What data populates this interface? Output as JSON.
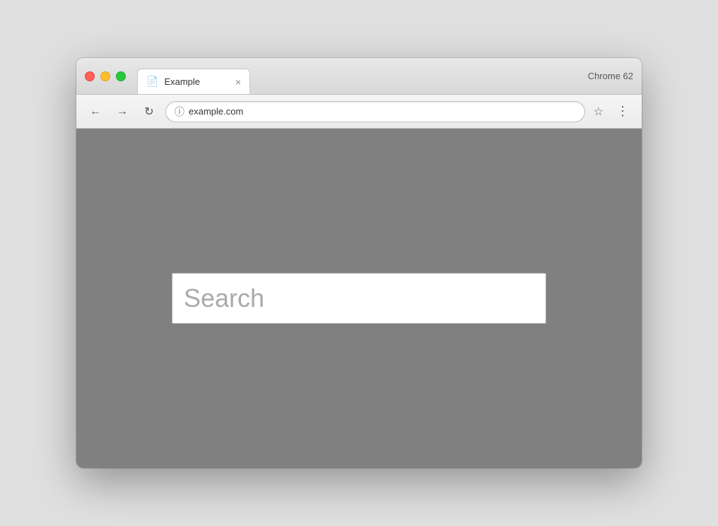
{
  "browser": {
    "chrome_label": "Chrome 62",
    "tab": {
      "title": "Example",
      "icon": "📄",
      "close": "×"
    },
    "toolbar": {
      "back_label": "←",
      "forward_label": "→",
      "reload_label": "↻",
      "address": "example.com",
      "info_icon": "ⓘ",
      "star_icon": "☆",
      "menu_icon": "⋮"
    }
  },
  "page": {
    "search_placeholder": "Search"
  }
}
